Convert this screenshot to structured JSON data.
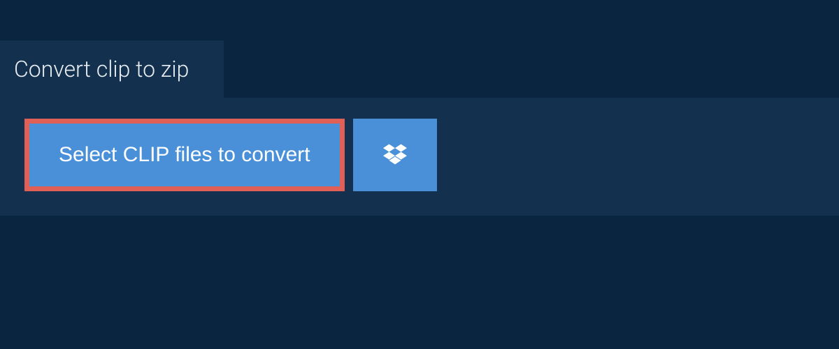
{
  "tab": {
    "title": "Convert clip to zip"
  },
  "actions": {
    "select_files_label": "Select CLIP files to convert"
  },
  "colors": {
    "background": "#0a2540",
    "panel": "#13314f",
    "button": "#4a90d9",
    "highlight_border": "#e06058",
    "text_light": "#e8edf2"
  }
}
